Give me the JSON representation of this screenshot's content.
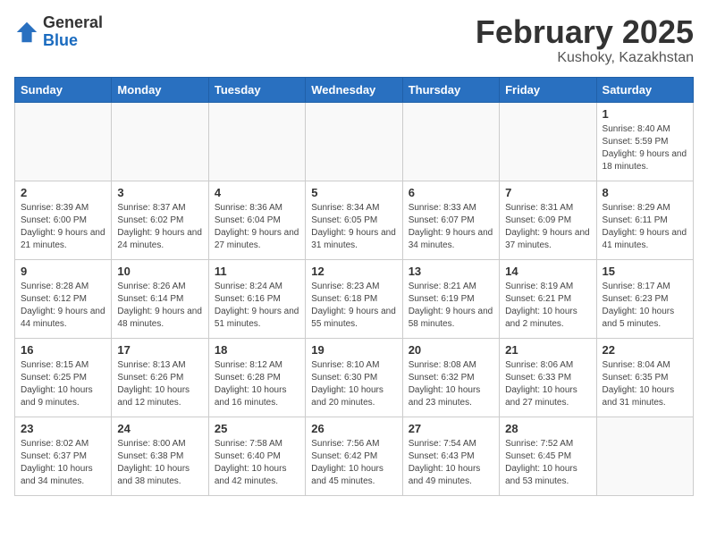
{
  "logo": {
    "general": "General",
    "blue": "Blue"
  },
  "title": "February 2025",
  "subtitle": "Kushoky, Kazakhstan",
  "days_header": [
    "Sunday",
    "Monday",
    "Tuesday",
    "Wednesday",
    "Thursday",
    "Friday",
    "Saturday"
  ],
  "weeks": [
    [
      {
        "num": "",
        "info": ""
      },
      {
        "num": "",
        "info": ""
      },
      {
        "num": "",
        "info": ""
      },
      {
        "num": "",
        "info": ""
      },
      {
        "num": "",
        "info": ""
      },
      {
        "num": "",
        "info": ""
      },
      {
        "num": "1",
        "info": "Sunrise: 8:40 AM\nSunset: 5:59 PM\nDaylight: 9 hours and 18 minutes."
      }
    ],
    [
      {
        "num": "2",
        "info": "Sunrise: 8:39 AM\nSunset: 6:00 PM\nDaylight: 9 hours and 21 minutes."
      },
      {
        "num": "3",
        "info": "Sunrise: 8:37 AM\nSunset: 6:02 PM\nDaylight: 9 hours and 24 minutes."
      },
      {
        "num": "4",
        "info": "Sunrise: 8:36 AM\nSunset: 6:04 PM\nDaylight: 9 hours and 27 minutes."
      },
      {
        "num": "5",
        "info": "Sunrise: 8:34 AM\nSunset: 6:05 PM\nDaylight: 9 hours and 31 minutes."
      },
      {
        "num": "6",
        "info": "Sunrise: 8:33 AM\nSunset: 6:07 PM\nDaylight: 9 hours and 34 minutes."
      },
      {
        "num": "7",
        "info": "Sunrise: 8:31 AM\nSunset: 6:09 PM\nDaylight: 9 hours and 37 minutes."
      },
      {
        "num": "8",
        "info": "Sunrise: 8:29 AM\nSunset: 6:11 PM\nDaylight: 9 hours and 41 minutes."
      }
    ],
    [
      {
        "num": "9",
        "info": "Sunrise: 8:28 AM\nSunset: 6:12 PM\nDaylight: 9 hours and 44 minutes."
      },
      {
        "num": "10",
        "info": "Sunrise: 8:26 AM\nSunset: 6:14 PM\nDaylight: 9 hours and 48 minutes."
      },
      {
        "num": "11",
        "info": "Sunrise: 8:24 AM\nSunset: 6:16 PM\nDaylight: 9 hours and 51 minutes."
      },
      {
        "num": "12",
        "info": "Sunrise: 8:23 AM\nSunset: 6:18 PM\nDaylight: 9 hours and 55 minutes."
      },
      {
        "num": "13",
        "info": "Sunrise: 8:21 AM\nSunset: 6:19 PM\nDaylight: 9 hours and 58 minutes."
      },
      {
        "num": "14",
        "info": "Sunrise: 8:19 AM\nSunset: 6:21 PM\nDaylight: 10 hours and 2 minutes."
      },
      {
        "num": "15",
        "info": "Sunrise: 8:17 AM\nSunset: 6:23 PM\nDaylight: 10 hours and 5 minutes."
      }
    ],
    [
      {
        "num": "16",
        "info": "Sunrise: 8:15 AM\nSunset: 6:25 PM\nDaylight: 10 hours and 9 minutes."
      },
      {
        "num": "17",
        "info": "Sunrise: 8:13 AM\nSunset: 6:26 PM\nDaylight: 10 hours and 12 minutes."
      },
      {
        "num": "18",
        "info": "Sunrise: 8:12 AM\nSunset: 6:28 PM\nDaylight: 10 hours and 16 minutes."
      },
      {
        "num": "19",
        "info": "Sunrise: 8:10 AM\nSunset: 6:30 PM\nDaylight: 10 hours and 20 minutes."
      },
      {
        "num": "20",
        "info": "Sunrise: 8:08 AM\nSunset: 6:32 PM\nDaylight: 10 hours and 23 minutes."
      },
      {
        "num": "21",
        "info": "Sunrise: 8:06 AM\nSunset: 6:33 PM\nDaylight: 10 hours and 27 minutes."
      },
      {
        "num": "22",
        "info": "Sunrise: 8:04 AM\nSunset: 6:35 PM\nDaylight: 10 hours and 31 minutes."
      }
    ],
    [
      {
        "num": "23",
        "info": "Sunrise: 8:02 AM\nSunset: 6:37 PM\nDaylight: 10 hours and 34 minutes."
      },
      {
        "num": "24",
        "info": "Sunrise: 8:00 AM\nSunset: 6:38 PM\nDaylight: 10 hours and 38 minutes."
      },
      {
        "num": "25",
        "info": "Sunrise: 7:58 AM\nSunset: 6:40 PM\nDaylight: 10 hours and 42 minutes."
      },
      {
        "num": "26",
        "info": "Sunrise: 7:56 AM\nSunset: 6:42 PM\nDaylight: 10 hours and 45 minutes."
      },
      {
        "num": "27",
        "info": "Sunrise: 7:54 AM\nSunset: 6:43 PM\nDaylight: 10 hours and 49 minutes."
      },
      {
        "num": "28",
        "info": "Sunrise: 7:52 AM\nSunset: 6:45 PM\nDaylight: 10 hours and 53 minutes."
      },
      {
        "num": "",
        "info": ""
      }
    ]
  ]
}
